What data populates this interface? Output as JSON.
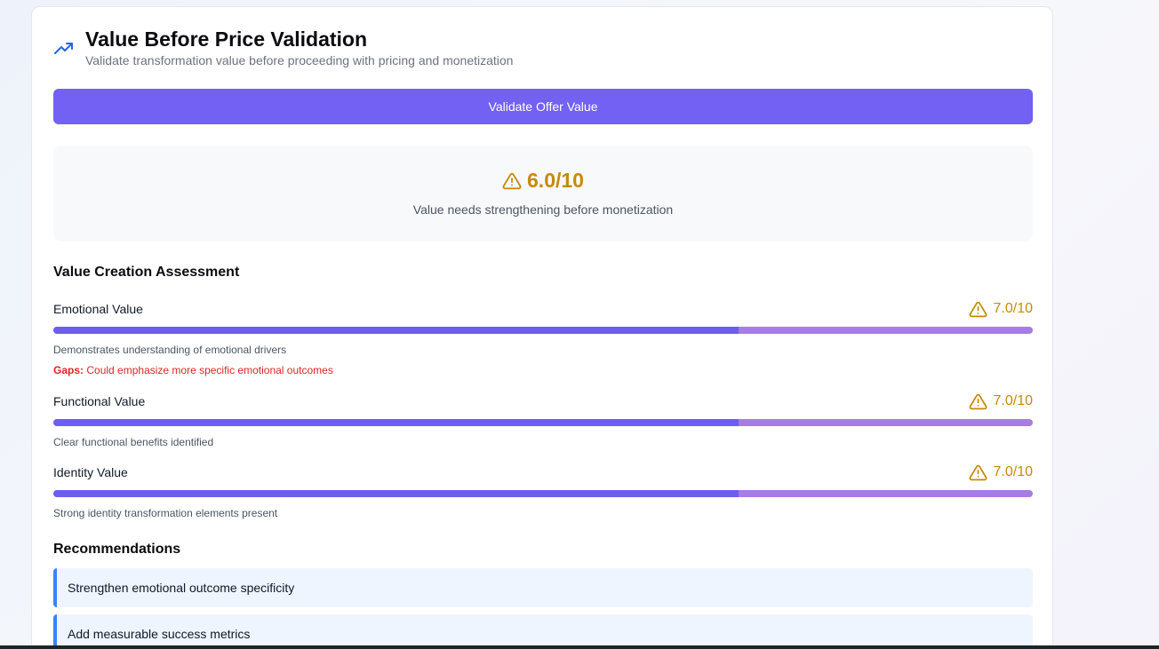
{
  "header": {
    "title": "Value Before Price Validation",
    "subtitle": "Validate transformation value before proceeding with pricing and monetization",
    "icon": "trending-up-icon"
  },
  "actions": {
    "validate_label": "Validate Offer Value"
  },
  "overall": {
    "score": "6.0/10",
    "caption": "Value needs strengthening before monetization",
    "icon": "warning-triangle-icon"
  },
  "assessment": {
    "title": "Value Creation Assessment",
    "metrics": [
      {
        "name": "Emotional Value",
        "score": "7.0/10",
        "fill": 0.7,
        "description": "Demonstrates understanding of emotional drivers",
        "gap_label": "Gaps:",
        "gap_text": "Could emphasize more specific emotional outcomes"
      },
      {
        "name": "Functional Value",
        "score": "7.0/10",
        "fill": 0.7,
        "description": "Clear functional benefits identified"
      },
      {
        "name": "Identity Value",
        "score": "7.0/10",
        "fill": 0.7,
        "description": "Strong identity transformation elements present"
      }
    ]
  },
  "recommendations": {
    "title": "Recommendations",
    "items": [
      "Strengthen emotional outcome specificity",
      "Add measurable success metrics"
    ]
  },
  "colors": {
    "accent": "#7261f2",
    "warning": "#c58a09",
    "gap": "#dc2626",
    "recommendation_border": "#3b82f6"
  }
}
